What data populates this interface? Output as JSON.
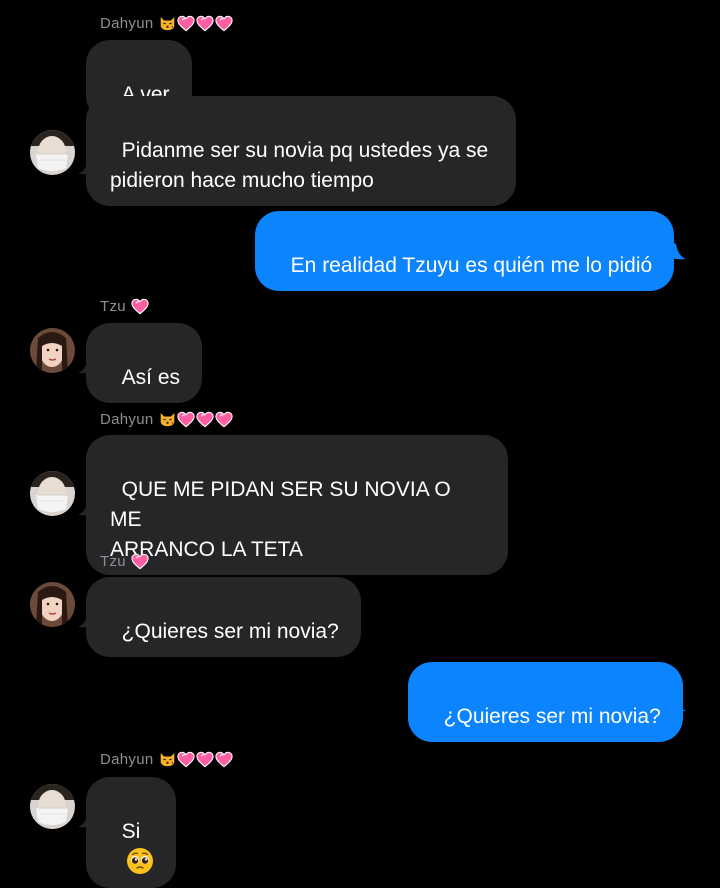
{
  "conversation": [
    {
      "sender": "Dahyun"
    },
    {
      "text": "A ver"
    },
    {
      "text": "Pidanme ser su novia pq ustedes ya se\npidieron hace mucho tiempo"
    },
    {
      "text": "En realidad Tzuyu es quién me lo pidió"
    },
    {
      "sender": "Tzu"
    },
    {
      "text": "Así es"
    },
    {
      "sender": "Dahyun"
    },
    {
      "text": "QUE ME PIDAN SER SU NOVIA O ME\nARRANCO LA TETA"
    },
    {
      "sender": "Tzu"
    },
    {
      "text": "¿Quieres ser mi novia?"
    },
    {
      "text": "¿Quieres ser mi novia?"
    },
    {
      "sender": "Dahyun"
    },
    {
      "text": "Si"
    }
  ],
  "icons": {
    "dahyun_badge": [
      "kissing-cat-icon",
      "pink-heart-icon",
      "pink-heart-icon",
      "pink-heart-icon"
    ],
    "tzu_badge": [
      "pink-heart-icon"
    ],
    "reaction": "pleading-face-icon"
  },
  "colors": {
    "background": "#000000",
    "received_bubble": "#262628",
    "sent_bubble": "#0b84fe",
    "sender_name": "#8e8e93",
    "heart": "#ff5fa2"
  }
}
